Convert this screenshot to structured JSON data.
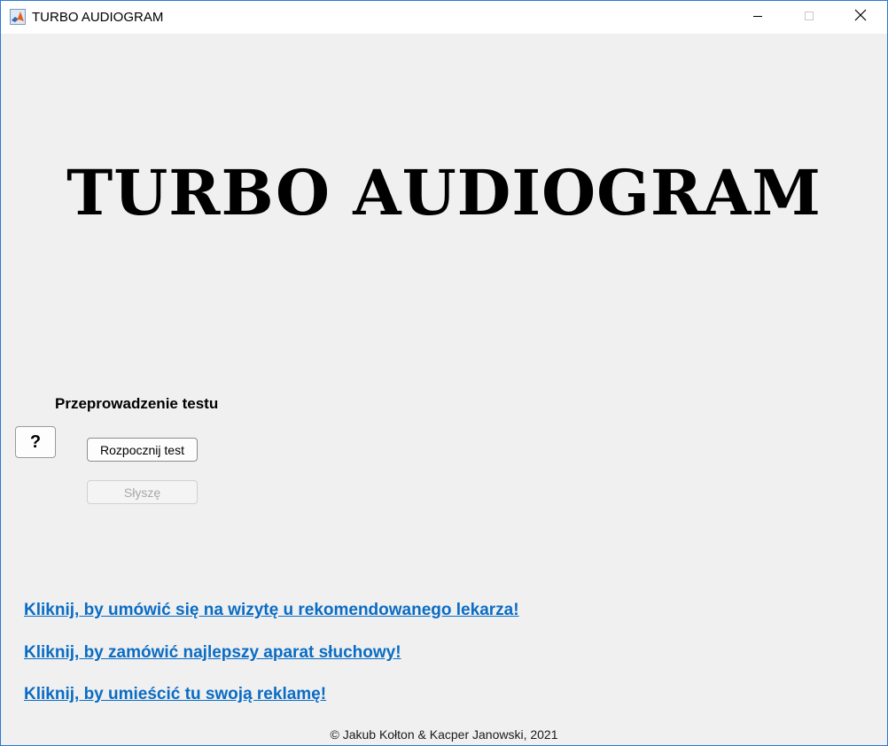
{
  "window": {
    "title": "TURBO AUDIOGRAM",
    "app_icon": "matlab-icon",
    "controls": {
      "minimize": "minimize-icon",
      "maximize": "maximize-icon",
      "close": "close-icon"
    }
  },
  "main": {
    "heading": "TURBO AUDIOGRAM",
    "section_label": "Przeprowadzenie testu",
    "help_label": "?",
    "start_button": "Rozpocznij test",
    "hear_button": "Słyszę"
  },
  "links": [
    "Kliknij, by umówić się na wizytę u rekomendowanego lekarza!",
    "Kliknij, by zamówić najlepszy aparat słuchowy!",
    "Kliknij, by umieścić tu swoją reklamę!"
  ],
  "footer": "© Jakub Kołton & Kacper Janowski, 2021",
  "colors": {
    "link": "#0a6cc4",
    "background": "#f0f0f0",
    "disabled_text": "#a8a8a8"
  }
}
